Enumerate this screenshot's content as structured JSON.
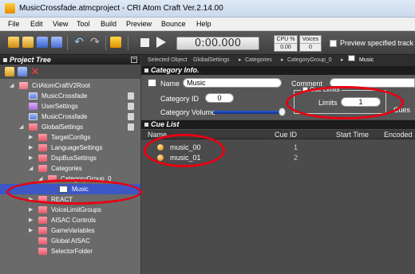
{
  "window": {
    "title": "MusicCrossfade.atmcproject - CRI Atom Craft Ver.2.14.00"
  },
  "menu": [
    "File",
    "Edit",
    "View",
    "Tool",
    "Build",
    "Preview",
    "Bounce",
    "Help"
  ],
  "toolbar": {
    "timecode": "0:00.000",
    "cpu_label": "CPU %",
    "cpu_value": "0.00",
    "voices_label": "Voices",
    "voices_value": "0",
    "preview_label": "Preview specified track"
  },
  "project_tree": {
    "header": "Project Tree",
    "items": [
      {
        "label": "CriAtomCraftV2Root"
      },
      {
        "label": "MusicCrossfade"
      },
      {
        "label": "UserSettings"
      },
      {
        "label": "MusicCrossfade"
      },
      {
        "label": "GlobalSettings"
      },
      {
        "label": "TargetConfigs"
      },
      {
        "label": "LanguageSettings"
      },
      {
        "label": "DspBusSettings"
      },
      {
        "label": "Categories"
      },
      {
        "label": "CategoryGroup_0"
      },
      {
        "label": "Music"
      },
      {
        "label": "REACT"
      },
      {
        "label": "VoiceLimitGroups"
      },
      {
        "label": "AISAC Controls"
      },
      {
        "label": "GameVariables"
      },
      {
        "label": "Global AISAC"
      },
      {
        "label": "SelectorFolder"
      }
    ]
  },
  "breadcrumb": {
    "label": "Selected Object",
    "items": [
      "GlobalSettings",
      "Categories",
      "CategoryGroup_0",
      "Music"
    ]
  },
  "category_info": {
    "header": "Category Info.",
    "name_label": "Name",
    "name_value": "Music",
    "comment_label": "Comment",
    "category_id_label": "Category ID",
    "category_id_value": "0",
    "category_volume_label": "Category Volume",
    "category_volume_level": 0.95,
    "cue_limits_label": "Cue Limits",
    "limits_label": "Limits",
    "limits_value": "1",
    "cues_label": "Cues"
  },
  "cue_list": {
    "header": "Cue List",
    "columns": [
      "Name",
      "Cue ID",
      "Start Time",
      "Encoded"
    ],
    "rows": [
      {
        "name": "music_00",
        "cue_id": "1"
      },
      {
        "name": "music_01",
        "cue_id": "2"
      }
    ]
  },
  "colors": {
    "annotation": "#e60012",
    "selection": "#3d57c5"
  }
}
